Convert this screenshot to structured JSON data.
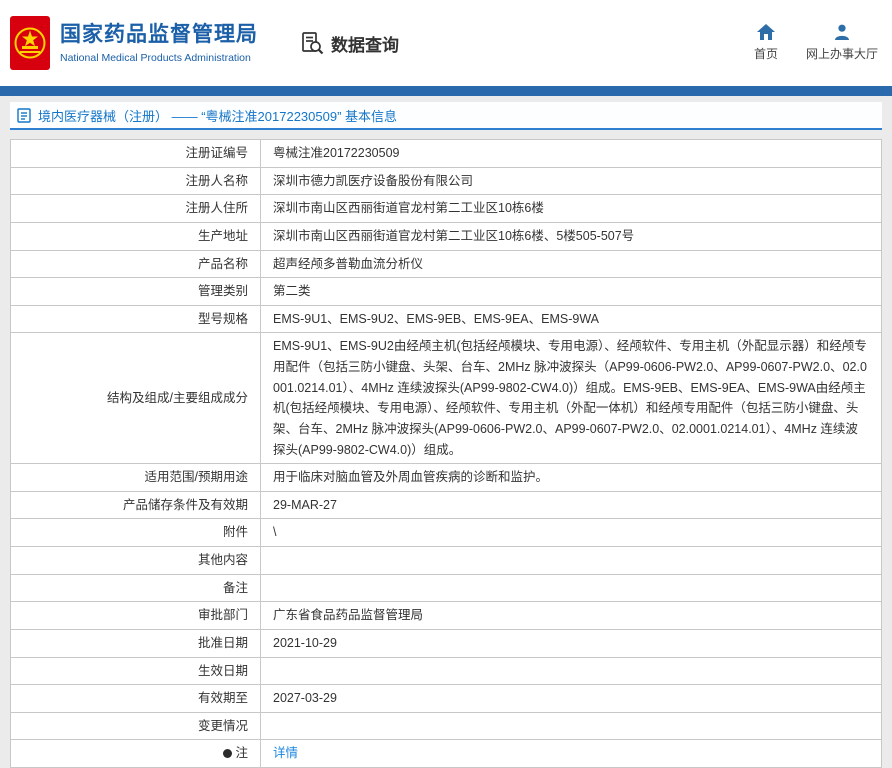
{
  "header": {
    "org_name_cn": "国家药品监督管理局",
    "org_name_en": "National Medical Products Administration",
    "nav": {
      "data_query": "数据查询",
      "home": "首页",
      "online_hall": "网上办事大厅"
    }
  },
  "page": {
    "title": "境内医疗器械（注册） ——  “粤械注准20172230509”  基本信息"
  },
  "table": {
    "rows": [
      {
        "label": "注册证编号",
        "value": "粤械注准20172230509"
      },
      {
        "label": "注册人名称",
        "value": "深圳市德力凯医疗设备股份有限公司"
      },
      {
        "label": "注册人住所",
        "value": "深圳市南山区西丽街道官龙村第二工业区10栋6楼"
      },
      {
        "label": "生产地址",
        "value": "深圳市南山区西丽街道官龙村第二工业区10栋6楼、5楼505-507号"
      },
      {
        "label": "产品名称",
        "value": "超声经颅多普勒血流分析仪"
      },
      {
        "label": "管理类别",
        "value": "第二类"
      },
      {
        "label": "型号规格",
        "value": "EMS-9U1、EMS-9U2、EMS-9EB、EMS-9EA、EMS-9WA"
      },
      {
        "label": "结构及组成/主要组成成分",
        "value": "EMS-9U1、EMS-9U2由经颅主机(包括经颅模块、专用电源）、经颅软件、专用主机（外配显示器）和经颅专用配件（包括三防小键盘、头架、台车、2MHz 脉冲波探头（AP99-0606-PW2.0、AP99-0607-PW2.0、02.0001.0214.01）、4MHz 连续波探头(AP99-9802-CW4.0)）组成。EMS-9EB、EMS-9EA、EMS-9WA由经颅主机(包括经颅模块、专用电源）、经颅软件、专用主机（外配一体机）和经颅专用配件（包括三防小键盘、头架、台车、2MHz 脉冲波探头(AP99-0606-PW2.0、AP99-0607-PW2.0、02.0001.0214.01）、4MHz 连续波探头(AP99-9802-CW4.0)）组成。"
      },
      {
        "label": "适用范围/预期用途",
        "value": "用于临床对脑血管及外周血管疾病的诊断和监护。"
      },
      {
        "label": "产品储存条件及有效期",
        "value": "29-MAR-27"
      },
      {
        "label": "附件",
        "value": "\\"
      },
      {
        "label": "其他内容",
        "value": ""
      },
      {
        "label": "备注",
        "value": ""
      },
      {
        "label": "审批部门",
        "value": "广东省食品药品监督管理局"
      },
      {
        "label": "批准日期",
        "value": "2021-10-29"
      },
      {
        "label": "生效日期",
        "value": ""
      },
      {
        "label": "有效期至",
        "value": "2027-03-29"
      },
      {
        "label": "变更情况",
        "value": ""
      },
      {
        "label": "注",
        "icon": "note-icon",
        "value": "详情",
        "link": true
      }
    ]
  },
  "colors": {
    "brand_blue": "#1a5fa8",
    "bar_blue": "#2a69ac",
    "title_blue": "#1576c8",
    "link_blue": "#1a87e0",
    "emblem_red": "#d6000f",
    "emblem_yellow": "#ffd200"
  }
}
